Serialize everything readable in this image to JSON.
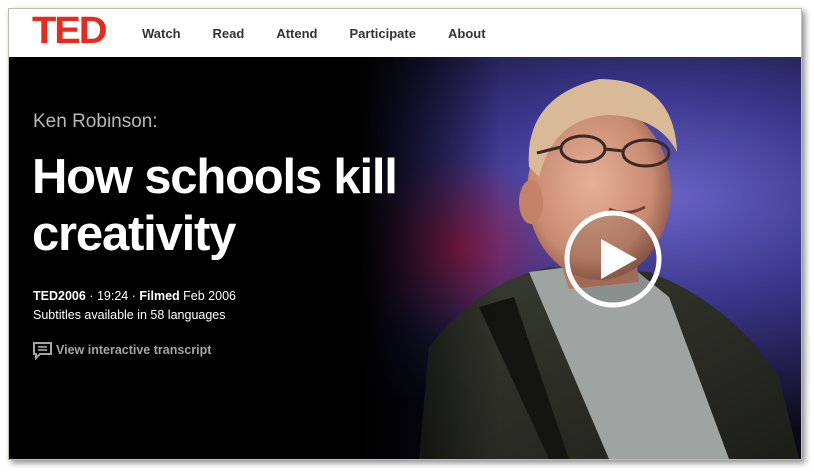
{
  "header": {
    "logo": "TED",
    "nav": [
      "Watch",
      "Read",
      "Attend",
      "Participate",
      "About"
    ]
  },
  "talk": {
    "speaker": "Ken Robinson:",
    "title": "How schools kill creativity",
    "event": "TED2006",
    "separator": "·",
    "duration": "19:24",
    "filmed_label": "Filmed",
    "filmed_date": "Feb 2006",
    "subtitles": "Subtitles available in 58 languages",
    "transcript_link": "View interactive transcript"
  },
  "colors": {
    "brand_red": "#e62b1e",
    "hero_background": "#000000",
    "nav_text": "#333333"
  },
  "icons": [
    "transcript-icon",
    "play-icon"
  ]
}
